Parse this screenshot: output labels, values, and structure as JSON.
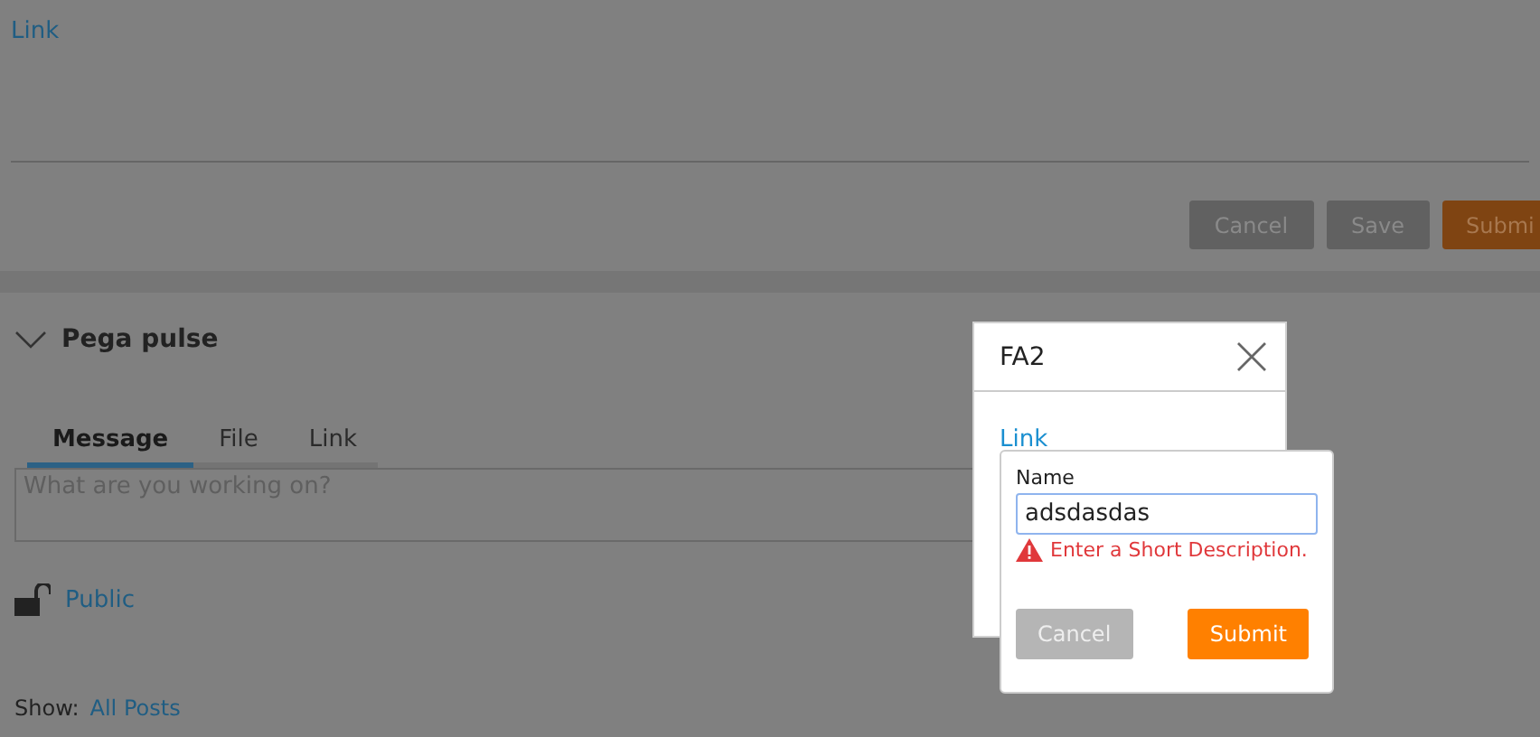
{
  "top_form": {
    "link": "Link",
    "buttons": [
      {
        "label": "Cancel",
        "kind": "secondary"
      },
      {
        "label": "Save",
        "kind": "secondary"
      },
      {
        "label": "Submi",
        "kind": "primary"
      }
    ]
  },
  "pulse": {
    "title": "Pega pulse",
    "expanded": true,
    "tabs": [
      {
        "label": "Message",
        "selected": true
      },
      {
        "label": "File",
        "selected": false
      },
      {
        "label": "Link",
        "selected": false
      }
    ],
    "message": {
      "placeholder": "What are you working on?"
    },
    "visibility": "Public",
    "show_label": "Show:",
    "show_value": "All Posts"
  },
  "dialog": {
    "title": "FA2",
    "link": "Link"
  },
  "popover": {
    "label": "Name",
    "value": "adsdasdas",
    "error": "Enter a Short Description.",
    "buttons": [
      {
        "label": "Cancel",
        "kind": "secondary"
      },
      {
        "label": "Submit",
        "kind": "primary"
      }
    ]
  }
}
